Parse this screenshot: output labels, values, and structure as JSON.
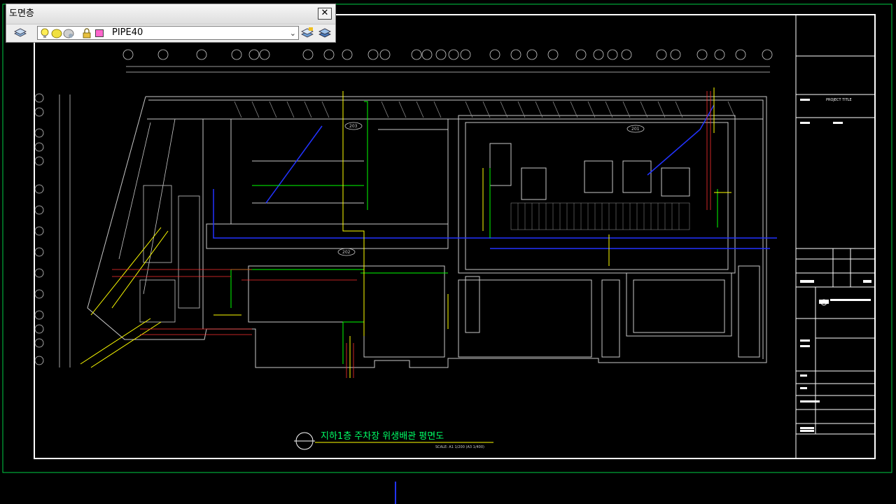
{
  "layer_panel": {
    "title": "도면층",
    "close_label": "✕",
    "current_layer": "PIPE40"
  },
  "drawing": {
    "title": "지하1층 주차장 위생배관 평면도",
    "scale_note": "SCALE: A1 1/200  (A3 1/400)",
    "room_labels": [
      "203",
      "201",
      "202"
    ],
    "project_label": "PROJECT TITLE"
  },
  "colors": {
    "background": "#000000",
    "border": "#ffffff",
    "outer_frame": "#00cc44",
    "wall": "#c8c8c8",
    "pipe_yellow": "#ffff00",
    "pipe_green": "#00ff00",
    "pipe_blue": "#2233ff",
    "pipe_red": "#ff3030",
    "title_green": "#00ff66"
  }
}
